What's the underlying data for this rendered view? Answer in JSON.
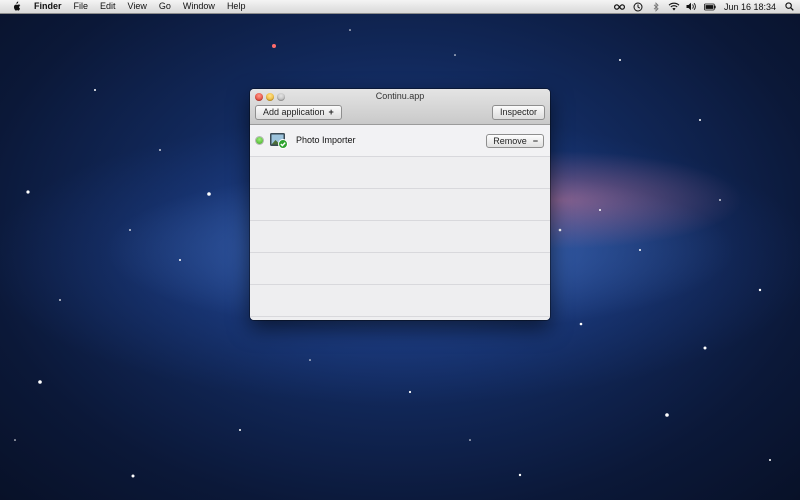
{
  "menubar": {
    "apple_icon": "apple-logo-icon",
    "items": [
      {
        "label": "Finder",
        "bold": true
      },
      {
        "label": "File"
      },
      {
        "label": "Edit"
      },
      {
        "label": "View"
      },
      {
        "label": "Go"
      },
      {
        "label": "Window"
      },
      {
        "label": "Help"
      }
    ],
    "status_icons": [
      "infinity-icon",
      "time-machine-icon",
      "bluetooth-icon",
      "wifi-icon",
      "volume-icon",
      "battery-icon"
    ],
    "clock": "Jun 16  18:34",
    "spotlight_icon": "spotlight-search-icon"
  },
  "window": {
    "title": "Continu.app",
    "add_button_label": "Add application",
    "add_button_glyph": "+",
    "inspector_button_label": "Inspector",
    "apps": [
      {
        "name": "Photo Importer",
        "status": "running",
        "status_color": "#3ca521",
        "icon": "photo-importer-app-icon",
        "remove_label": "Remove",
        "remove_glyph": "−"
      }
    ]
  },
  "colors": {
    "desktop_bg": "#122a5e",
    "status_green": "#3ca521",
    "close_red": "#d8261a",
    "minimize_yellow": "#e3a312"
  }
}
